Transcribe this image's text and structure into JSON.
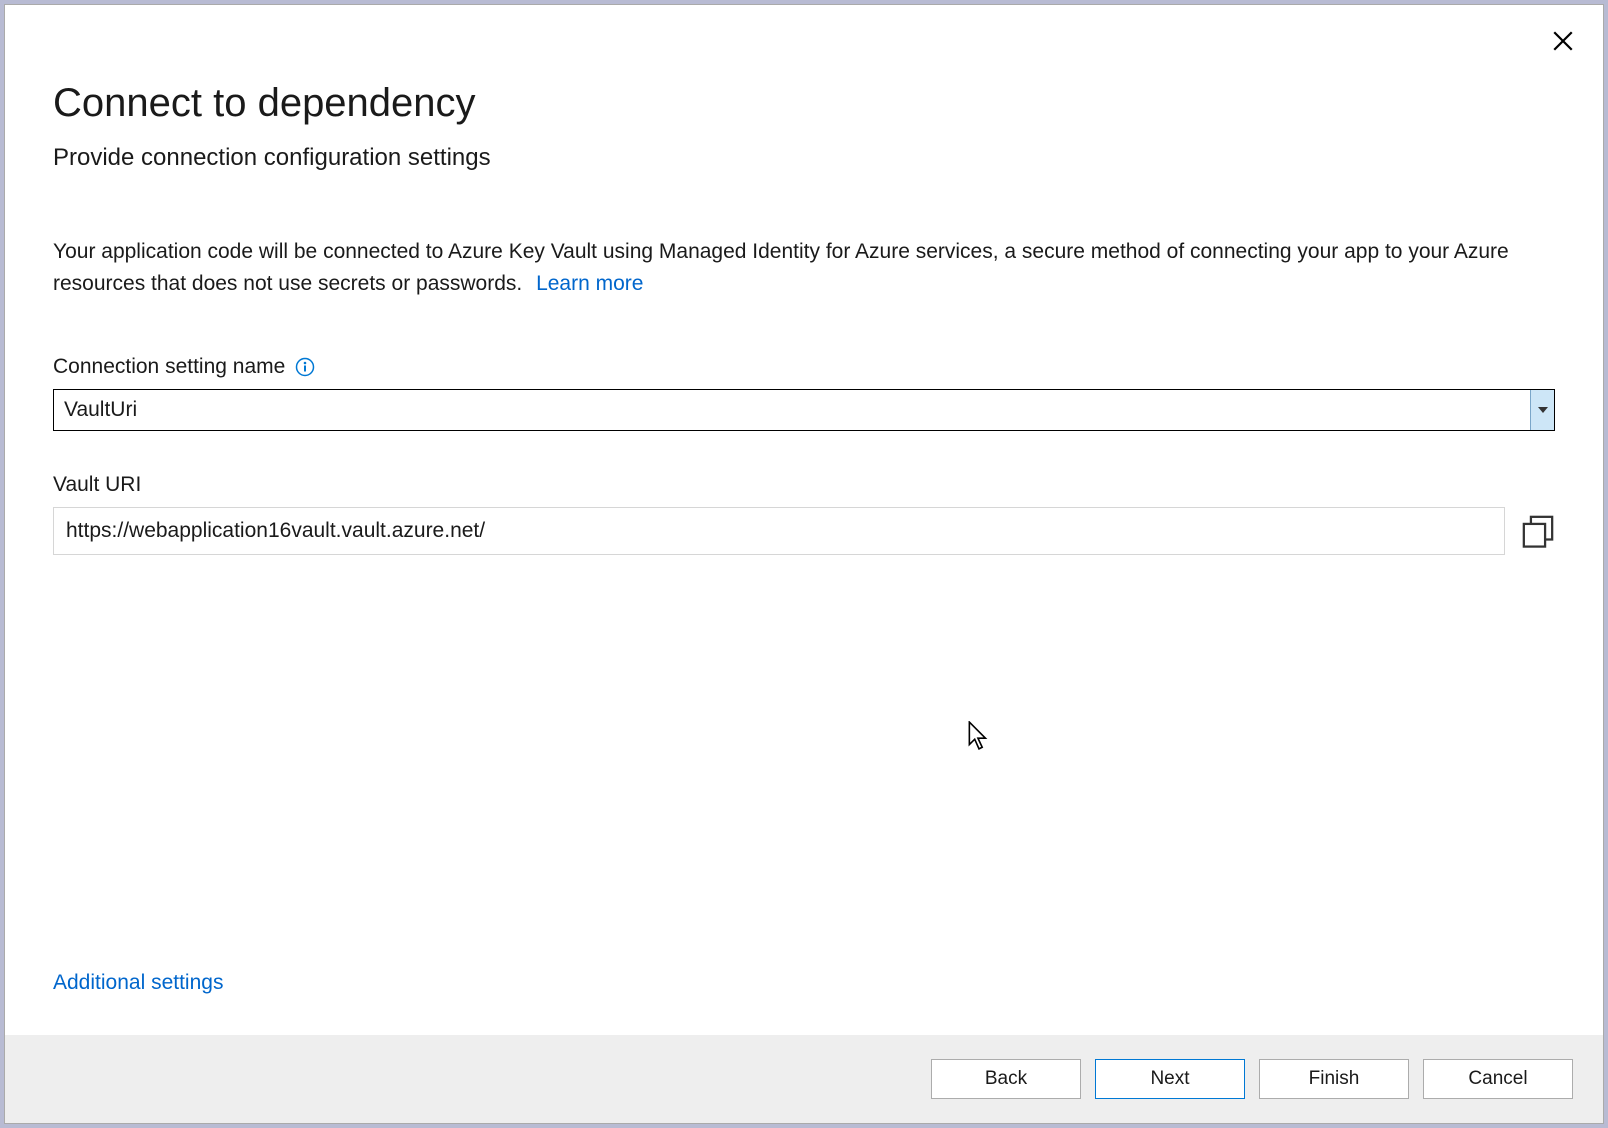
{
  "dialog": {
    "title": "Connect to dependency",
    "subtitle": "Provide connection configuration settings",
    "description": "Your application code will be connected to Azure Key Vault using Managed Identity for Azure services, a secure method of connecting your app to your Azure resources that does not use secrets or passwords.",
    "learn_more_text": "Learn more"
  },
  "fields": {
    "connection_name": {
      "label": "Connection setting name",
      "value": "VaultUri"
    },
    "vault_uri": {
      "label": "Vault URI",
      "value": "https://webapplication16vault.vault.azure.net/"
    }
  },
  "links": {
    "additional_settings": "Additional settings"
  },
  "buttons": {
    "back": "Back",
    "next": "Next",
    "finish": "Finish",
    "cancel": "Cancel"
  }
}
